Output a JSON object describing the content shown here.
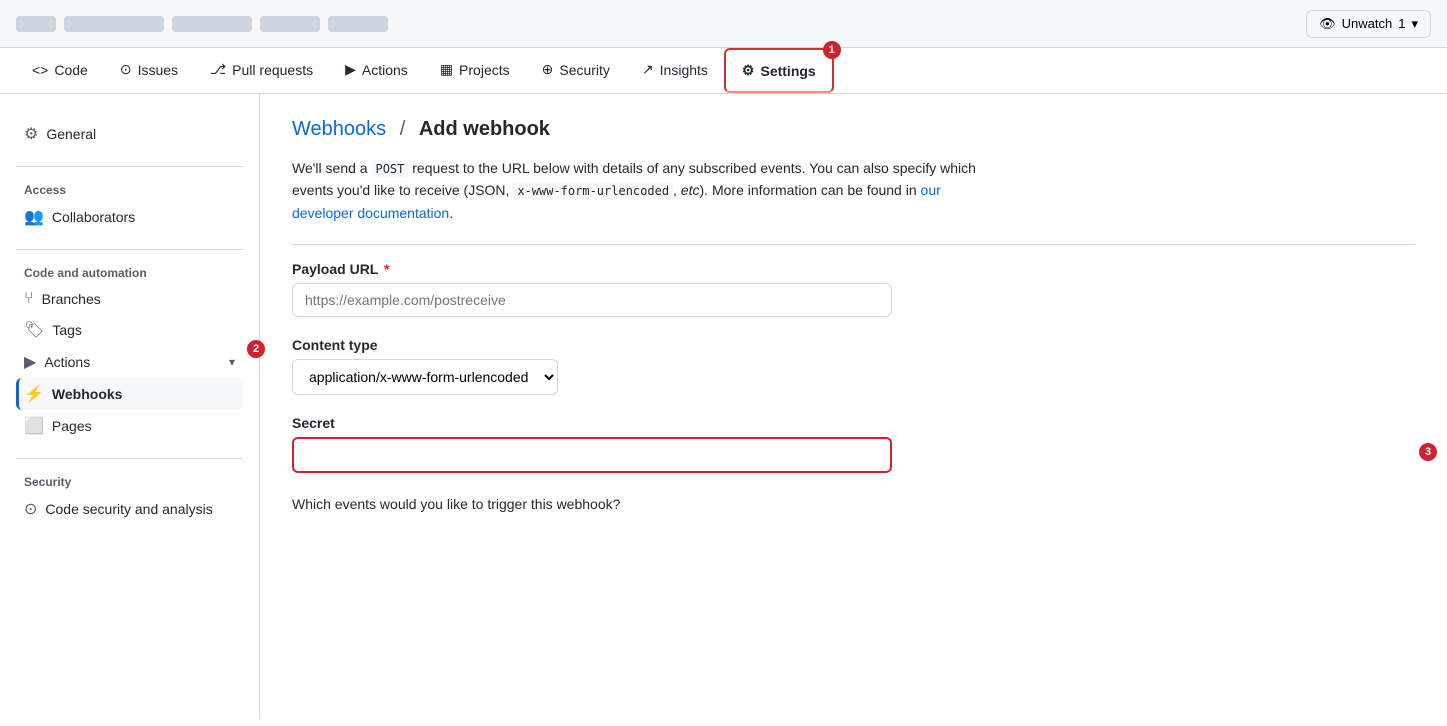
{
  "topbar": {
    "placeholders": [
      40,
      100,
      80,
      60,
      60
    ],
    "unwatch_icon": "👁",
    "unwatch_label": "Unwatch",
    "unwatch_count": "1",
    "dropdown_icon": "▾"
  },
  "nav": {
    "tabs": [
      {
        "label": "Code",
        "icon": "<>",
        "active": false
      },
      {
        "label": "Issues",
        "icon": "⊙",
        "active": false
      },
      {
        "label": "Pull requests",
        "icon": "⎇",
        "active": false
      },
      {
        "label": "Actions",
        "icon": "▶",
        "active": false
      },
      {
        "label": "Projects",
        "icon": "▦",
        "active": false
      },
      {
        "label": "Security",
        "icon": "⊕",
        "active": false
      },
      {
        "label": "Insights",
        "icon": "↗",
        "active": false
      },
      {
        "label": "Settings",
        "icon": "⚙",
        "active": true
      }
    ],
    "settings_badge": "1"
  },
  "sidebar": {
    "general_label": "General",
    "sections": [
      {
        "label": "Access",
        "items": [
          {
            "label": "Collaborators",
            "icon": "👥"
          }
        ]
      },
      {
        "label": "Code and automation",
        "items": [
          {
            "label": "Branches",
            "icon": "⑂"
          },
          {
            "label": "Tags",
            "icon": "🏷"
          },
          {
            "label": "Actions",
            "icon": "▶",
            "has_chevron": true
          },
          {
            "label": "Webhooks",
            "icon": "⚡",
            "active": true
          },
          {
            "label": "Pages",
            "icon": "⬜"
          }
        ]
      },
      {
        "label": "Security",
        "items": [
          {
            "label": "Code security and analysis",
            "icon": "⊙"
          }
        ]
      }
    ],
    "actions_badge": "2"
  },
  "main": {
    "breadcrumb_link": "Webhooks",
    "breadcrumb_sep": "/",
    "breadcrumb_current": "Add webhook",
    "description": "We'll send a POST request to the URL below with details of any subscribed events. You can also specify which events you'd like to receive (JSON, x-www-form-urlencoded, etc). More information can be found in our developer documentation.",
    "payload_url_label": "Payload URL",
    "payload_url_required": "*",
    "payload_url_placeholder": "https://example.com/postreceive",
    "content_type_label": "Content type",
    "content_type_value": "application/x-www-form-urlencoded",
    "secret_label": "Secret",
    "secret_badge": "3",
    "events_label": "Which events would you like to trigger this webhook?"
  }
}
